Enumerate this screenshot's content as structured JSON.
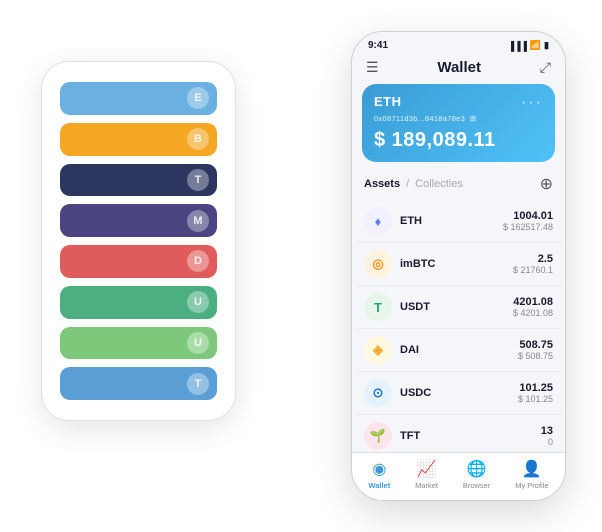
{
  "backPhone": {
    "cards": [
      {
        "color": "#6ab0e0",
        "iconText": "E"
      },
      {
        "color": "#f5a623",
        "iconText": "B"
      },
      {
        "color": "#2d3561",
        "iconText": "T"
      },
      {
        "color": "#4a4580",
        "iconText": "M"
      },
      {
        "color": "#e05c5c",
        "iconText": "D"
      },
      {
        "color": "#4caf82",
        "iconText": "U"
      },
      {
        "color": "#7dc87a",
        "iconText": "U"
      },
      {
        "color": "#5b9ed6",
        "iconText": "T"
      }
    ]
  },
  "frontPhone": {
    "statusBar": {
      "time": "9:41",
      "signal": "▐▐▐",
      "wifi": "WiFi",
      "battery": "■"
    },
    "header": {
      "menuIcon": "☰",
      "title": "Wallet",
      "expandIcon": "⤢"
    },
    "ethCard": {
      "title": "ETH",
      "address": "0x08711d3b...8418a78e3",
      "addressSuffix": "⊞",
      "amount": "$ 189,089.11",
      "dotsMenu": "···"
    },
    "assetsTabs": {
      "active": "Assets",
      "separator": "/",
      "inactive": "Collecties",
      "addIcon": "⊕"
    },
    "assets": [
      {
        "name": "ETH",
        "iconText": "♦",
        "iconClass": "eth-icon",
        "amountPrimary": "1004.01",
        "amountSecondary": "$ 162517.48"
      },
      {
        "name": "imBTC",
        "iconText": "◎",
        "iconClass": "imbtc-icon",
        "amountPrimary": "2.5",
        "amountSecondary": "$ 21760.1"
      },
      {
        "name": "USDT",
        "iconText": "T",
        "iconClass": "usdt-icon",
        "amountPrimary": "4201.08",
        "amountSecondary": "$ 4201.08"
      },
      {
        "name": "DAI",
        "iconText": "◈",
        "iconClass": "dai-icon",
        "amountPrimary": "508.75",
        "amountSecondary": "$ 508.75"
      },
      {
        "name": "USDC",
        "iconText": "⊙",
        "iconClass": "usdc-icon",
        "amountPrimary": "101.25",
        "amountSecondary": "$ 101.25"
      },
      {
        "name": "TFT",
        "iconText": "🌱",
        "iconClass": "tft-icon",
        "amountPrimary": "13",
        "amountSecondary": "0"
      }
    ],
    "bottomNav": [
      {
        "icon": "◎",
        "label": "Wallet",
        "active": true
      },
      {
        "icon": "📈",
        "label": "Market",
        "active": false
      },
      {
        "icon": "⊕",
        "label": "Browser",
        "active": false
      },
      {
        "icon": "👤",
        "label": "My Profile",
        "active": false
      }
    ]
  }
}
